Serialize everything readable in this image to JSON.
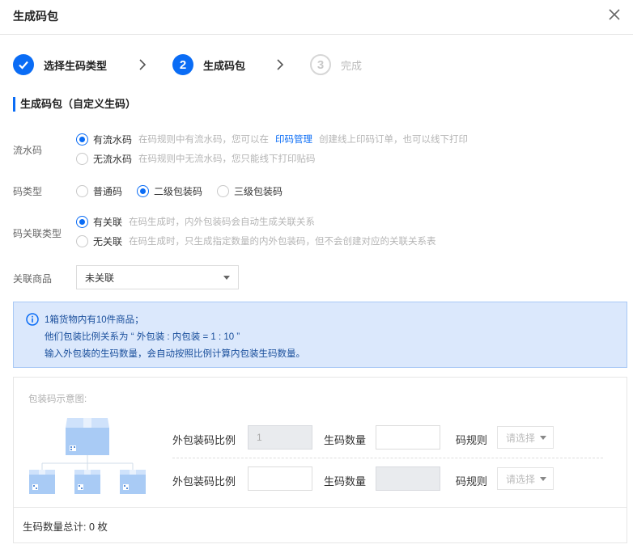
{
  "dialog": {
    "title": "生成码包"
  },
  "steps": [
    {
      "number": "",
      "label": "选择生码类型",
      "state": "done"
    },
    {
      "number": "2",
      "label": "生成码包",
      "state": "active"
    },
    {
      "number": "3",
      "label": "完成",
      "state": "pending"
    }
  ],
  "section": {
    "title": "生成码包（自定义生码）"
  },
  "serial": {
    "label": "流水码",
    "options": [
      {
        "text": "有流水码",
        "hint_before": "在码规则中有流水码，您可以在",
        "link": "印码管理",
        "hint_after": "创建线上印码订单，也可以线下打印",
        "checked": true
      },
      {
        "text": "无流水码",
        "hint": "在码规则中无流水码，您只能线下打印贴码",
        "checked": false
      }
    ]
  },
  "code_type": {
    "label": "码类型",
    "options": [
      {
        "text": "普通码",
        "checked": false
      },
      {
        "text": "二级包装码",
        "checked": true
      },
      {
        "text": "三级包装码",
        "checked": false
      }
    ]
  },
  "relation": {
    "label": "码关联类型",
    "options": [
      {
        "text": "有关联",
        "hint": "在码生成时，内外包装码会自动生成关联关系",
        "checked": true
      },
      {
        "text": "无关联",
        "hint": "在码生成时，只生成指定数量的内外包装码，但不会创建对应的关联关系表",
        "checked": false
      }
    ]
  },
  "product": {
    "label": "关联商品",
    "value": "未关联"
  },
  "notice": {
    "lines": [
      "1箱货物内有10件商品；",
      "他们包装比例关系为 “ 外包装 : 内包装 = 1 : 10 ”",
      "输入外包装的生码数量，会自动按照比例计算内包装生码数量。"
    ],
    "bg_color": "#dbe8fc",
    "text_color": "#1a4f9c"
  },
  "diagram": {
    "caption": "包装码示意图:",
    "rows": [
      {
        "ratio_label": "外包装码比例",
        "ratio_value": "1",
        "ratio_disabled": true,
        "count_label": "生码数量",
        "count_value": "",
        "count_disabled": false,
        "rule_label": "码规则",
        "rule_placeholder": "请选择"
      },
      {
        "ratio_label": "外包装码比例",
        "ratio_value": "",
        "ratio_disabled": false,
        "count_label": "生码数量",
        "count_value": "",
        "count_disabled": true,
        "rule_label": "码规则",
        "rule_placeholder": "请选择"
      }
    ],
    "total": "生码数量总计: 0 枚"
  },
  "colors": {
    "accent": "#0a6cf5"
  }
}
